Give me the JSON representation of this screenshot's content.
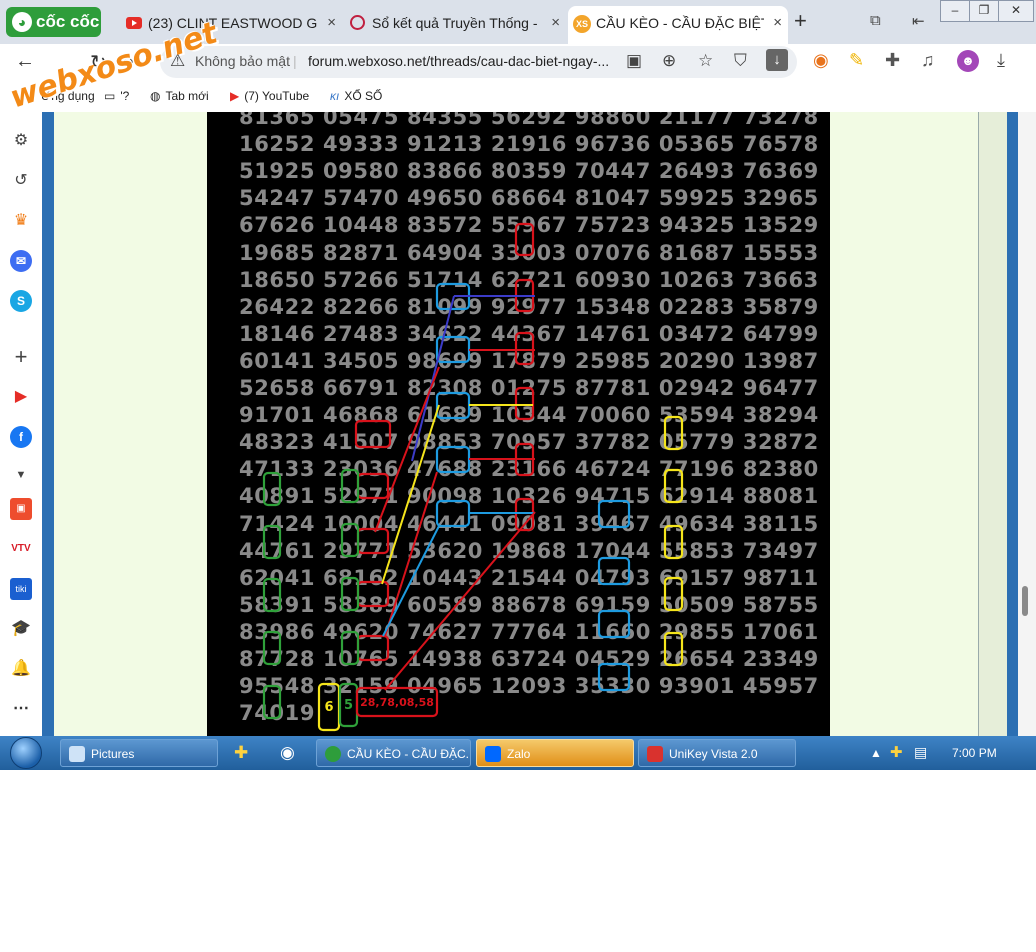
{
  "browser": {
    "brand": "cốc cốc",
    "tabs": [
      {
        "label": "(23) CLINT EASTWOOD G",
        "active": false
      },
      {
        "label": "Sổ kết quả Truyền Thống -",
        "active": false
      },
      {
        "label": "CẦU KÈO - CẦU ĐẶC BIỆT",
        "active": true
      }
    ],
    "new_tab_label": "+",
    "close_glyph": "×",
    "security_label": "Không bảo mật",
    "url": "forum.webxoso.net/threads/cau-dac-biet-ngay-...",
    "bookmarks": [
      {
        "icon": "apps-grid-icon",
        "label": "Ứng dụng"
      },
      {
        "icon": "folder-icon",
        "label": "'?"
      },
      {
        "icon": "globe-icon",
        "label": "Tab mới"
      },
      {
        "icon": "youtube-icon",
        "label": "(7) YouTube"
      },
      {
        "icon": "xoso-icon",
        "label": "XỔ SỐ"
      }
    ]
  },
  "watermark": "webxoso.net",
  "board": {
    "rows": [
      "81365 05475 84355 56292 98860 21177 73278",
      "16252 49333 91213 21916 96736 05365 76578",
      "51925 09580 83866 80359 70447 26493 76369",
      "54247 57470 49650 68664 81047 59925 32965",
      "67626 10448 83572 55967 75723 94325 13529",
      "19685 82871 64904 33003 07076 81687 15553",
      "18650 57266 51714 62721 60930 10263 73663",
      "26422 82266 81099 92977 15348 02283 35879",
      "18146 27483 34622 44367 14761 03472 64799",
      "60141 34505 98699 17879 25985 20290 13987",
      "52658 66791 82308 01275 87781 02942 96477",
      "91701 46868 61689 10344 70060 53594 38294",
      "48323 41507 98853 70957 37782 05779 32872",
      "47133 23036 47688 23166 46724 77196 82380",
      "40891 52971 90098 10326 94715 62914 88081",
      "71424 10004 46441 09081 39467 49634 38115",
      "44761 29771 53620 19868 17044 55853 73497",
      "62041 68162 10443 21544 04793 69157 98711",
      "58391 58389 60589 88678 69159 50509 58755",
      "83986 49620 74627 77764 11660 29855 17061",
      "87728 10765 14938 63724 04529 26654 23349",
      "95548 32159 04965 12093 35330 93901 45957",
      "74019"
    ],
    "note_yellow": "6",
    "note_green": "5",
    "note_red": "28,78,08,58",
    "colors": {
      "red": "#d8121b",
      "blue": "#1e9be0",
      "green": "#2fa13a",
      "yellow": "#f5e51b",
      "line_blue": "#3b3bc8",
      "digits": "#8a8a8a"
    }
  },
  "taskbar": {
    "buttons": [
      {
        "label": "Pictures",
        "icon": "pictures-folder-icon"
      },
      {
        "label": "CẦU KÈO - CẦU ĐẶC...",
        "icon": "coccoc-icon"
      },
      {
        "label": "Zalo",
        "icon": "zalo-icon"
      },
      {
        "label": "UniKey Vista 2.0",
        "icon": "unikey-icon"
      }
    ],
    "clock": "7:00 PM"
  }
}
